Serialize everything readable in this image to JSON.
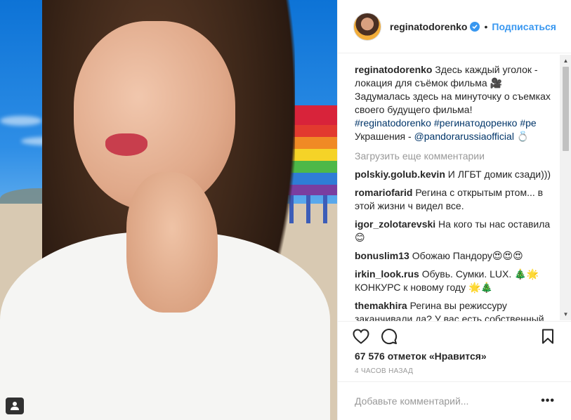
{
  "post": {
    "username": "reginatodorenko",
    "follow_label": "Подписаться",
    "dot": "•"
  },
  "caption": {
    "username": "reginatodorenko",
    "text_1": "Здесь каждый уголок - локация для съёмок фильма 🎥 ",
    "text_2": "Задумалась здесь на минуточку о съемках своего будущего фильма! ",
    "tag_1": "#reginatodorenko",
    "tag_2": "#регинатодоренко",
    "tag_3": "#ре",
    "text_3": "Украшения - ",
    "mention": "@pandorarussiaofficial",
    "text_4": " 💍"
  },
  "load_more_label": "Загрузить еще комментарии",
  "comments": [
    {
      "user": "polskiy.golub.kevin",
      "text": "И ЛГБТ домик сзади)))"
    },
    {
      "user": "romariofarid",
      "text": "Регина с открытым ртом... в этой жизни ч видел все."
    },
    {
      "user": "igor_zolotarevski",
      "text": "На кого ты нас оставила 😊"
    },
    {
      "user": "bonuslim13",
      "text": "Обожаю Пандору😍😍😍"
    },
    {
      "user": "irkin_look.rus",
      "text": "Обувь. Сумки. LUX. 🎄🌟 КОНКУРС к новому году 🌟🎄"
    },
    {
      "user": "themakhira",
      "text": "Регина вы режиссуру заканчивали да? У вас есть собственный фильм например снятая для экзамена на"
    }
  ],
  "likes_text": "67 576 отметок «Нравится»",
  "time_text": "4 ЧАСОВ НАЗАД",
  "add_comment_placeholder": "Добавьте комментарий...",
  "more_label": "•••",
  "icons": {
    "like": "heart-icon",
    "comment": "comment-icon",
    "save": "bookmark-icon",
    "verified": "verified-badge-icon",
    "user_tag": "user-tag-icon"
  },
  "colors": {
    "link": "#003569",
    "follow": "#3897f0",
    "muted": "#999999",
    "text": "#262626"
  }
}
